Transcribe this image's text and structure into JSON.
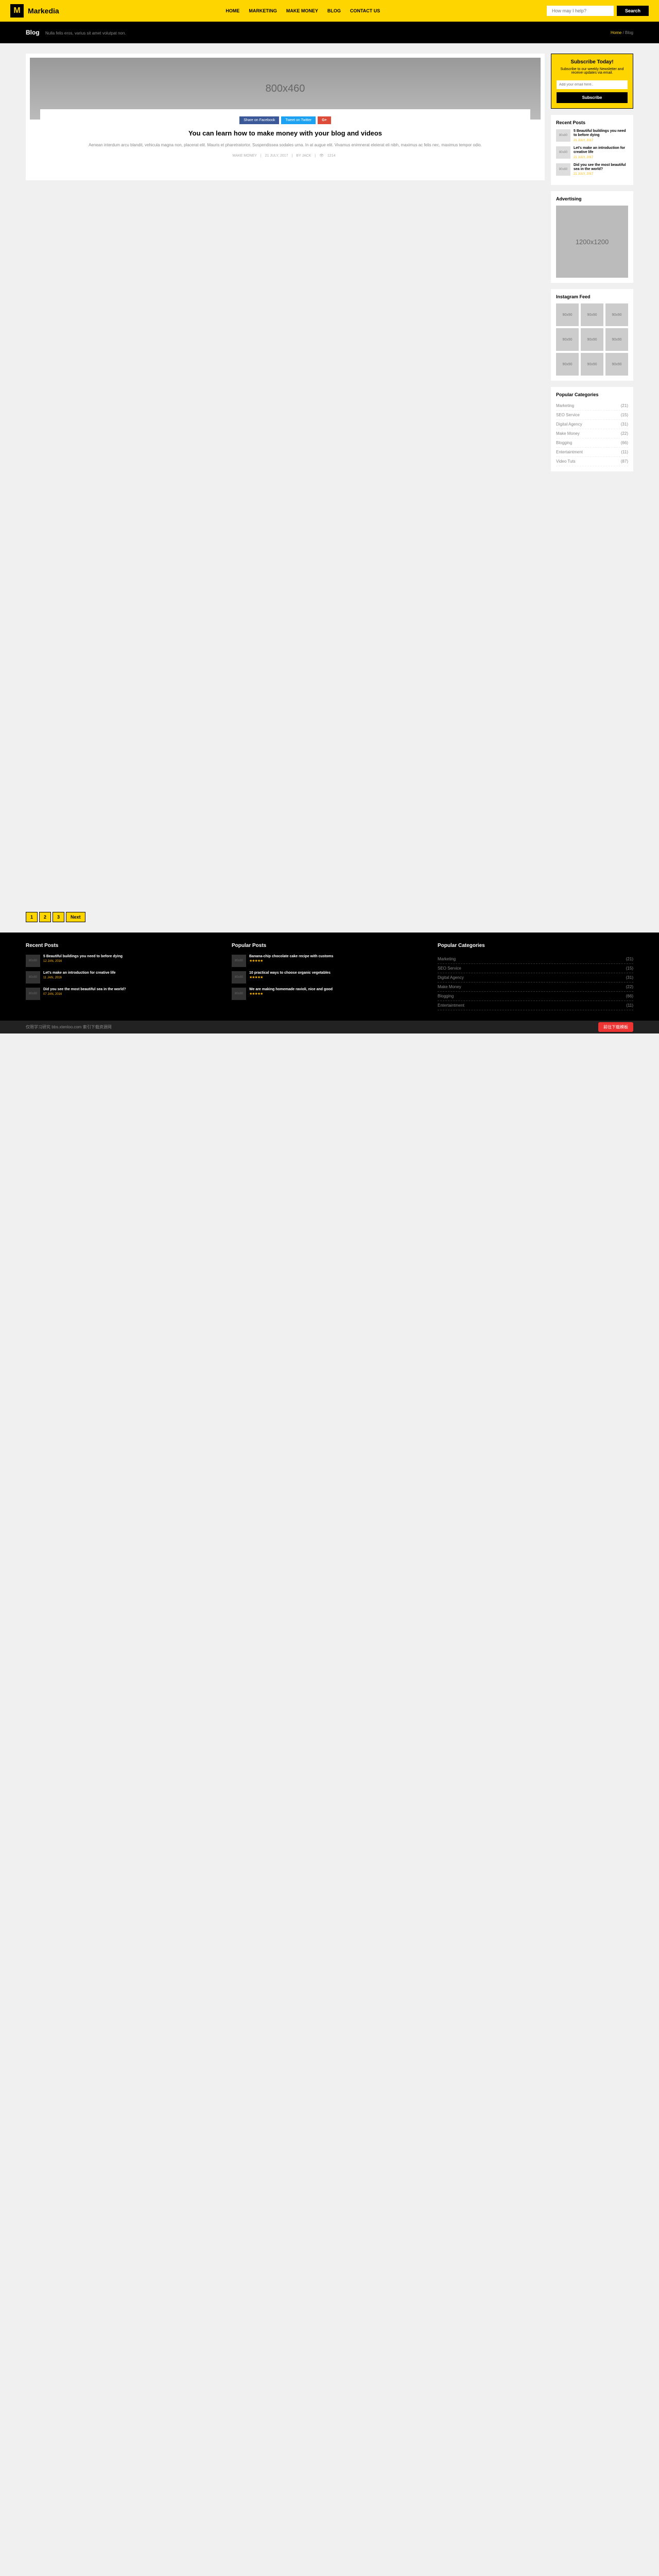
{
  "header": {
    "logo_letter": "M",
    "logo_text": "Markedia",
    "nav": [
      "HOME",
      "MARKETING",
      "MAKE MONEY",
      "BLOG",
      "CONTACT US"
    ],
    "search_placeholder": "How may I help?",
    "search_btn": "Search"
  },
  "page_bar": {
    "title": "Blog",
    "subtitle": "Nulla felis eros, varius sit amet volutpat non.",
    "crumb_home": "Home",
    "crumb_current": "Blog"
  },
  "post": {
    "img_label": "800x460",
    "share_fb": "Share on Facebook",
    "share_tw": "Tweet on Twitter",
    "share_gp": "G+",
    "title": "You can learn how to make money with your blog and videos",
    "excerpt": "Aenean interdum arcu blandit, vehicula magna non, placerat elit. Mauris et pharetratortor. Suspendissea sodales urna. In at augue elit. Vivamus enimnerat eleierat eli nibh, maximus ac felis nec, maximus tempor odio.",
    "meta_cat": "MAKE MONEY",
    "meta_date": "21 JULY, 2017",
    "meta_by": "BY JACK",
    "meta_views": "1214"
  },
  "pagination": [
    "1",
    "2",
    "3",
    "Next"
  ],
  "subscribe": {
    "title": "Subscribe Today!",
    "text": "Subscribe to our weekly Newsletter and receive updates via email.",
    "placeholder": "Add your email here..",
    "btn": "Subscribe"
  },
  "recent_posts": {
    "title": "Recent Posts",
    "items": [
      {
        "thumb": "80x80",
        "title": "5 Beautiful buildings you need to before dying",
        "date": "21 JULY, 2017"
      },
      {
        "thumb": "80x80",
        "title": "Let's make an introduction for creative life",
        "date": "21 JULY, 2017"
      },
      {
        "thumb": "80x80",
        "title": "Did you see the most beautiful sea in the world?",
        "date": "21 JULY, 2017"
      }
    ]
  },
  "advertising": {
    "title": "Advertising",
    "img": "1200x1200"
  },
  "instagram": {
    "title": "Instagram Feed",
    "thumb": "90x90"
  },
  "categories": {
    "title": "Popular Categories",
    "items": [
      {
        "name": "Marketing",
        "count": "(21)"
      },
      {
        "name": "SEO Service",
        "count": "(15)"
      },
      {
        "name": "Digital Agency",
        "count": "(31)"
      },
      {
        "name": "Make Money",
        "count": "(22)"
      },
      {
        "name": "Blogging",
        "count": "(66)"
      },
      {
        "name": "Entertaintment",
        "count": "(11)"
      },
      {
        "name": "Video Tuts",
        "count": "(87)"
      }
    ]
  },
  "footer": {
    "recent": {
      "title": "Recent Posts",
      "items": [
        {
          "thumb": "80x80",
          "title": "5 Beautiful buildings you need to before dying",
          "date": "12 JAN, 2016"
        },
        {
          "thumb": "80x80",
          "title": "Let's make an introduction for creative life",
          "date": "11 JAN, 2016"
        },
        {
          "thumb": "80x80",
          "title": "Did you see the most beautiful sea in the world?",
          "date": "07 JAN, 2016"
        }
      ]
    },
    "popular": {
      "title": "Popular Posts",
      "items": [
        {
          "thumb": "80x80",
          "title": "Banana-chip chocolate cake recipe with customs",
          "stars": "★★★★★"
        },
        {
          "thumb": "80x80",
          "title": "10 practical ways to choose organic vegetables",
          "stars": "★★★★★"
        },
        {
          "thumb": "80x80",
          "title": "We are making homemade ravioli, nice and good",
          "stars": "★★★★★"
        }
      ]
    },
    "cats": {
      "title": "Popular Categories",
      "items": [
        {
          "name": "Marketing",
          "count": "(21)"
        },
        {
          "name": "SEO Service",
          "count": "(15)"
        },
        {
          "name": "Digital Agency",
          "count": "(31)"
        },
        {
          "name": "Make Money",
          "count": "(22)"
        },
        {
          "name": "Blogging",
          "count": "(66)"
        },
        {
          "name": "Entertaintment",
          "count": "(11)"
        }
      ]
    }
  },
  "watermark": {
    "left": "仅限学习研究 bbs.xtenloo.com 索引下载资源网",
    "right": "前往下载模板"
  }
}
